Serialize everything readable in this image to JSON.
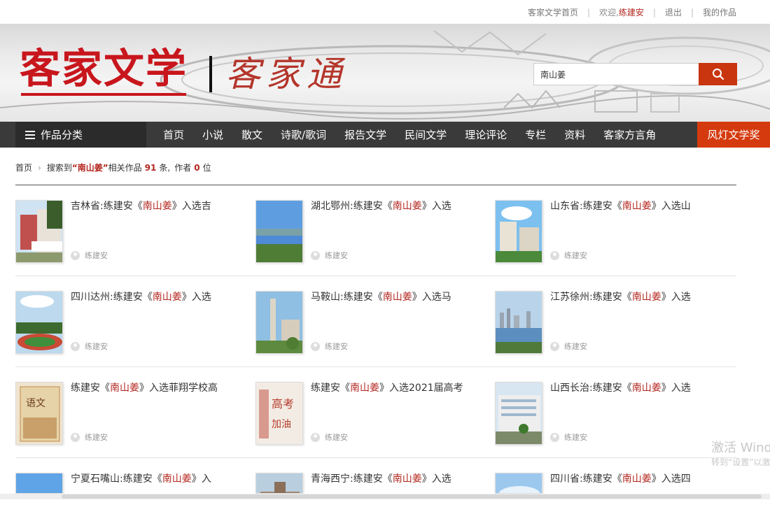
{
  "topbar": {
    "home_link": "客家文学首页",
    "welcome": "欢迎,",
    "username": "练建安",
    "logout": "退出",
    "my_works": "我的作品"
  },
  "banner": {
    "logo_main": "客家文学",
    "logo_sub": "客家通"
  },
  "search": {
    "value": "南山姜",
    "icon": "search-icon"
  },
  "nav": {
    "category_label": "作品分类",
    "items": [
      "首页",
      "小说",
      "散文",
      "诗歌/歌词",
      "报告文学",
      "民间文学",
      "理论评论",
      "专栏",
      "资料",
      "客家方言角"
    ],
    "award": "风灯文学奖"
  },
  "breadcrumb": {
    "home": "首页",
    "prefix": "搜索到",
    "open_quote": "“",
    "keyword": "南山姜",
    "close_quote": "”",
    "works_text": "相关作品",
    "works_count": "91",
    "works_unit": "条,",
    "author_text": "作者",
    "author_count": "0",
    "author_unit": "位"
  },
  "results": [
    {
      "pre": "吉林省:练建安《",
      "hl": "南山姜",
      "post": "》入选吉",
      "author": "练建安",
      "thumb": "building-red"
    },
    {
      "pre": "湖北鄂州:练建安《",
      "hl": "南山姜",
      "post": "》入选",
      "author": "练建安",
      "thumb": "lake-city"
    },
    {
      "pre": "山东省:练建安《",
      "hl": "南山姜",
      "post": "》入选山",
      "author": "练建安",
      "thumb": "campus-sky"
    },
    {
      "pre": "四川达州:练建安《",
      "hl": "南山姜",
      "post": "》入选",
      "author": "练建安",
      "thumb": "stadium"
    },
    {
      "pre": "马鞍山:练建安《",
      "hl": "南山姜",
      "post": "》入选马",
      "author": "练建安",
      "thumb": "tower"
    },
    {
      "pre": "江苏徐州:练建安《",
      "hl": "南山姜",
      "post": "》入选",
      "author": "练建安",
      "thumb": "lake-skyline"
    },
    {
      "pre": "练建安《",
      "hl": "南山姜",
      "post": "》入选菲翔学校高",
      "author": "练建安",
      "thumb": "book-cover"
    },
    {
      "pre": "练建安《",
      "hl": "南山姜",
      "post": "》入选2021届高考",
      "author": "练建安",
      "thumb": "exam-poster"
    },
    {
      "pre": "山西长治:练建安《",
      "hl": "南山姜",
      "post": "》入选",
      "author": "练建安",
      "thumb": "school-building"
    },
    {
      "pre": "宁夏石嘴山:练建安《",
      "hl": "南山姜",
      "post": "》入",
      "author": "",
      "thumb": "sky-blue"
    },
    {
      "pre": "青海西宁:练建安《",
      "hl": "南山姜",
      "post": "》入选",
      "author": "",
      "thumb": "old-building"
    },
    {
      "pre": "四川省:练建安《",
      "hl": "南山姜",
      "post": "》入选四",
      "author": "",
      "thumb": "sky-cloud"
    }
  ],
  "watermark": {
    "line1": "激活 Wind",
    "line2": "转到“设置”以激"
  },
  "colors": {
    "accent": "#b3261e",
    "nav_bg": "#3a3a3a",
    "award_bg": "#d53a0f",
    "search_btn": "#c8350e"
  }
}
